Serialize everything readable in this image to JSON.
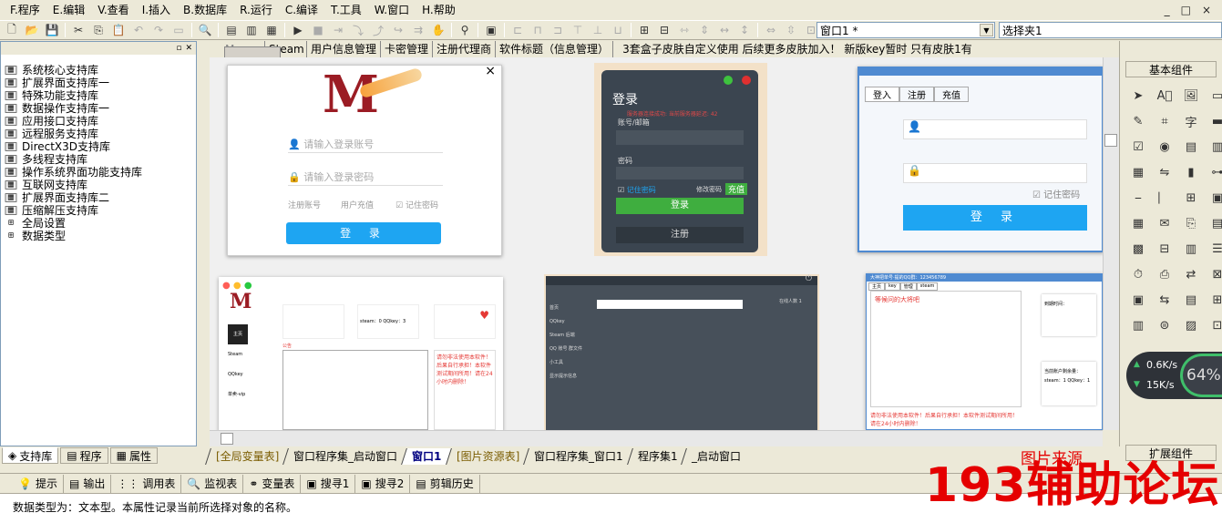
{
  "menubar": {
    "items": [
      "F.程序",
      "E.编辑",
      "V.查看",
      "I.插入",
      "B.数据库",
      "R.运行",
      "C.编译",
      "T.工具",
      "W.窗口",
      "H.帮助"
    ],
    "window_buttons": [
      "_",
      "□",
      "×"
    ]
  },
  "toolbar": {
    "window_combo": "窗口1 *",
    "folder_combo": "选择夹1"
  },
  "left_panel": {
    "tree": [
      "系统核心支持库",
      "扩展界面支持库一",
      "特殊功能支持库",
      "数据操作支持库一",
      "应用接口支持库",
      "远程服务支持库",
      "DirectX3D支持库",
      "多线程支持库",
      "操作系统界面功能支持库",
      "互联网支持库",
      "扩展界面支持库二",
      "压缩解压支持库",
      "全局设置",
      "数据类型"
    ],
    "tabs": [
      "支持库",
      "程序",
      "属性"
    ]
  },
  "doc_tabs": [
    "Mamm",
    "Steam",
    "用户信息管理",
    "卡密管理",
    "注册代理商",
    "软件标题（信息管理）",
    "3套盒子皮肤自定义使用 后续更多皮肤加入！ 新版key暂时 只有皮肤1有"
  ],
  "canvas": {
    "card1": {
      "user_placeholder": "请输入登录账号",
      "pass_placeholder": "请输入登录密码",
      "register": "注册账号",
      "recharge": "用户充值",
      "remember": "记住密码",
      "login": "登 录"
    },
    "card2": {
      "title": "登录",
      "notice": "服务器连接成功: 当前服务器延迟: 42",
      "account": "账号/邮箱",
      "password": "密码",
      "remember": "记住密码",
      "change_pw": "修改密码",
      "recharge": "充值",
      "login": "登录",
      "register": "注册"
    },
    "card3": {
      "tabs": [
        "登入",
        "注册",
        "充值"
      ],
      "remember": "记住密码",
      "login": "登 录"
    },
    "card4": {
      "notice_title": "公告",
      "side": [
        "主页",
        "Steam",
        "QQkey",
        "单卖-vip"
      ],
      "steam_label": "steam：0 QQkey：3",
      "warn": "请勿非法使用本软件！后果自行承担！本软件测试期间所用！请在24小时内删除！"
    },
    "card5": {
      "menu": [
        "首页",
        "QQkey",
        "Steam 后端",
        "QQ 账号 群文件",
        "小工具",
        "显示提示信息"
      ],
      "online": "在线人数 1"
    },
    "card6": {
      "title": "大神把单号·提的QQ群：123456789",
      "tabs": [
        "主页",
        "key",
        "管理",
        "steam"
      ],
      "label1": "等候问的大将吧",
      "side1": "到期时间：",
      "side2": "当前账户剩余量：",
      "side3": "steam：1 QQkey：1",
      "warn": "请勿非法使用本软件！后果自行承担！本软件测试期间所用！请在24小时内删除！"
    }
  },
  "bottom_tabs": [
    "[全局变量表]",
    "窗口程序集_启动窗口",
    "窗口1",
    "[图片资源表]",
    "窗口程序集_窗口1",
    "程序集1",
    "_启动窗口"
  ],
  "right_panel": {
    "title": "基本组件",
    "title2": "扩展组件",
    "speed_up": "0.6K/s",
    "speed_down": "15K/s",
    "cpu": "64%"
  },
  "output_tabs": [
    "提示",
    "输出",
    "调用表",
    "监视表",
    "变量表",
    "搜寻1",
    "搜寻2",
    "剪辑历史"
  ],
  "status_text": "数据类型为：文本型。本属性记录当前所选择对象的名称。",
  "watermark": {
    "main": "193辅助论坛",
    "small": "图片来源"
  },
  "colors": {
    "accent_blue": "#1ea5f2",
    "brand_red": "#9b1c24",
    "green": "#3fae3f",
    "watermark_red": "#e50000"
  }
}
